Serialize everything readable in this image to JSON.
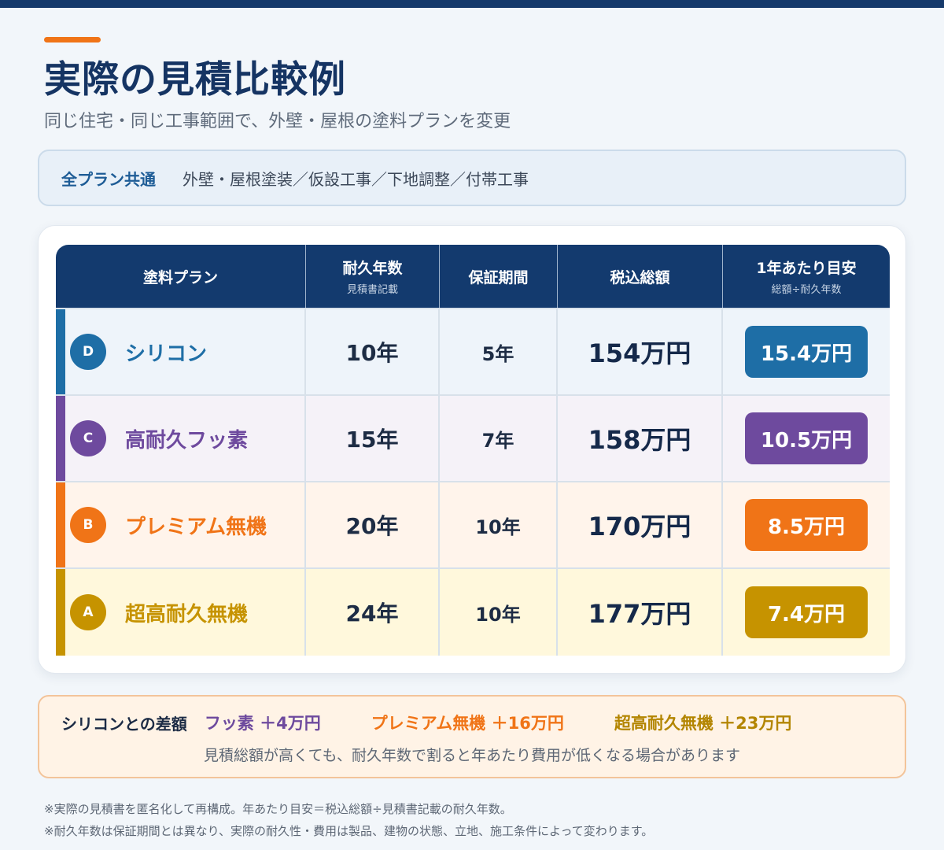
{
  "header": {
    "title": "実際の見積比較例",
    "subtitle": "同じ住宅・同じ工事範囲で、外壁・屋根の塗料プランを変更"
  },
  "common": {
    "label": "全プラン共通",
    "text": "外壁・屋根塗装／仮設工事／下地調整／付帯工事"
  },
  "table": {
    "headers": [
      {
        "main": "塗料プラン",
        "sub": ""
      },
      {
        "main": "耐久年数",
        "sub": "見積書記載"
      },
      {
        "main": "保証期間",
        "sub": ""
      },
      {
        "main": "税込総額",
        "sub": ""
      },
      {
        "main": "1年あたり目安",
        "sub": "総額÷耐久年数"
      }
    ],
    "rows": [
      {
        "badge": "D",
        "name": "シリコン",
        "years": "10年",
        "warranty": "5年",
        "total": "154万円",
        "per_year": "15.4万円",
        "color": "#1e6ea6",
        "bg": "#eef4fa"
      },
      {
        "badge": "C",
        "name": "高耐久フッ素",
        "years": "15年",
        "warranty": "7年",
        "total": "158万円",
        "per_year": "10.5万円",
        "color": "#6e4a9e",
        "bg": "#f5f2f8"
      },
      {
        "badge": "B",
        "name": "プレミアム無機",
        "years": "20年",
        "warranty": "10年",
        "total": "170万円",
        "per_year": "8.5万円",
        "color": "#f07417",
        "bg": "#fff4eb"
      },
      {
        "badge": "A",
        "name": "超高耐久無機",
        "years": "24年",
        "warranty": "10年",
        "total": "177万円",
        "per_year": "7.4万円",
        "color": "#c69300",
        "bg": "#fff8dc"
      }
    ]
  },
  "difference": {
    "label": "シリコンとの差額",
    "items": [
      {
        "text": "フッ素 ＋4万円",
        "color": "#6e4a9e"
      },
      {
        "text": "プレミアム無機 ＋16万円",
        "color": "#f07417"
      },
      {
        "text": "超高耐久無機 ＋23万円",
        "color": "#b38500"
      }
    ],
    "note": "見積総額が高くても、耐久年数で割ると年あたり費用が低くなる場合があります"
  },
  "footnotes": [
    "※実際の見積書を匿名化して再構成。年あたり目安＝税込総額÷見積書記載の耐久年数。",
    "※耐久年数は保証期間とは異なり、実際の耐久性・費用は製品、建物の状態、立地、施工条件によって変わります。"
  ]
}
